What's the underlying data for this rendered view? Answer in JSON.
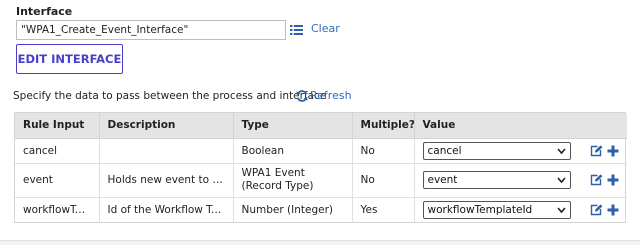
{
  "interface": {
    "label": "Interface",
    "value": "\"WPA1_Create_Event_Interface\"",
    "clear_label": "Clear",
    "edit_button_label": "EDIT INTERFACE"
  },
  "instructions": "Specify the data to pass between the process and interface",
  "refresh_label": "Refresh",
  "grid": {
    "columns": [
      "Rule Input",
      "Description",
      "Type",
      "Multiple?",
      "Value"
    ],
    "rows": [
      {
        "rule_input": "cancel",
        "description": "",
        "type": "Boolean",
        "multiple": "No",
        "value": "cancel"
      },
      {
        "rule_input": "event",
        "description": "Holds new event to be cr...",
        "type": "WPA1 Event (Record Type)",
        "multiple": "No",
        "value": "event"
      },
      {
        "rule_input": "workflowTe...",
        "description": "Id of the Workflow Temp...",
        "type": "Number (Integer)",
        "multiple": "Yes",
        "value": "workflowTemplateId"
      }
    ]
  },
  "colors": {
    "link": "#2f6bbf",
    "button_accent": "#4a40c8",
    "header_bg": "#e4e4e4",
    "icon_blue": "#2e5fa8"
  },
  "icons": [
    "list-icon",
    "refresh-icon",
    "edit-icon",
    "add-icon",
    "chevron-down-icon"
  ]
}
